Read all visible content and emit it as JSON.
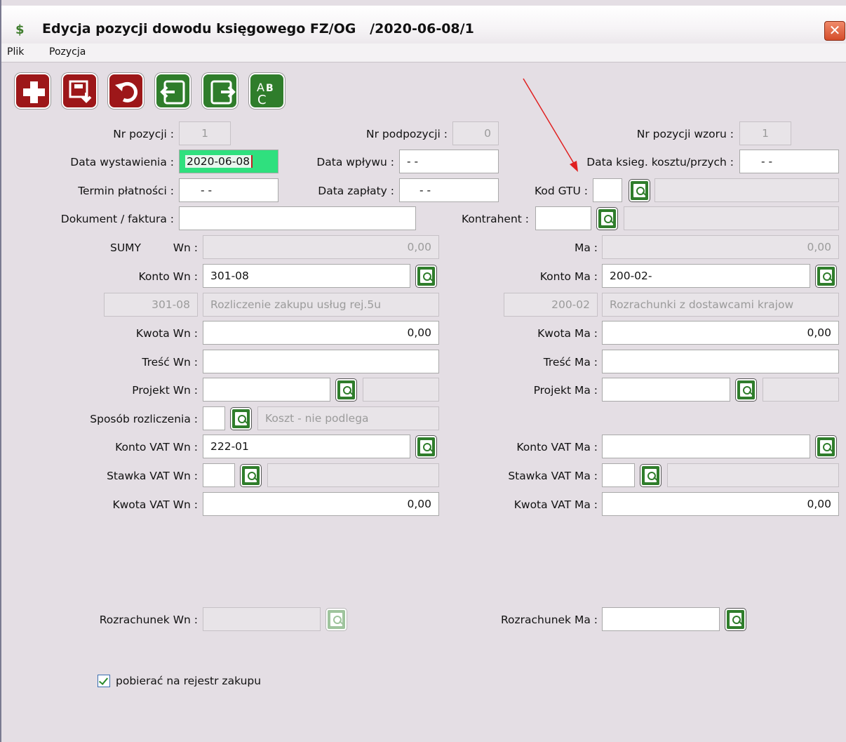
{
  "window": {
    "title": "Edycja pozycji dowodu księgowego FZ/OG   /2020-06-08/1",
    "close": "✕"
  },
  "menu": {
    "file": "Plik",
    "position": "Pozycja"
  },
  "toolbar": {
    "add": "add-icon",
    "save": "save-icon",
    "undo": "undo-icon",
    "prev": "prev-icon",
    "next": "next-icon",
    "spell": "spellcheck-icon",
    "spell_text": "ABC"
  },
  "fields": {
    "nr_pozycji": {
      "label": "Nr pozycji :",
      "value": "1"
    },
    "nr_podpozycji": {
      "label": "Nr podpozycji :",
      "value": "0"
    },
    "nr_pozycji_wzoru": {
      "label": "Nr pozycji wzoru :",
      "value": "1"
    },
    "data_wystawienia": {
      "label": "Data wystawienia :",
      "value": "2020-06-08"
    },
    "data_wplywu": {
      "label": "Data wpływu :",
      "value": "- -"
    },
    "data_ksieg": {
      "label": "Data ksieg. kosztu/przych :",
      "value": "- -"
    },
    "termin_platnosci": {
      "label": "Termin płatności :",
      "value": "- -"
    },
    "data_zaplaty": {
      "label": "Data zapłaty :",
      "value": "- -"
    },
    "kod_gtu": {
      "label": "Kod GTU :",
      "value": "",
      "desc": ""
    },
    "dokument_faktura": {
      "label": "Dokument / faktura :",
      "value": ""
    },
    "kontrahent": {
      "label": "Kontrahent :",
      "value": "",
      "desc": ""
    },
    "sumy_label": "SUMY",
    "sumy_wn": {
      "label": "Wn :",
      "value": "0,00"
    },
    "sumy_ma": {
      "label": "Ma :",
      "value": "0,00"
    },
    "konto_wn": {
      "label": "Konto Wn :",
      "value": "301-08",
      "code": "301-08",
      "desc": "Rozliczenie  zakupu usług  rej.5u"
    },
    "konto_ma": {
      "label": "Konto Ma :",
      "value": "200-02-",
      "code": "200-02",
      "desc": "Rozrachunki  z  dostawcami krajow"
    },
    "kwota_wn": {
      "label": "Kwota Wn :",
      "value": "0,00"
    },
    "kwota_ma": {
      "label": "Kwota Ma :",
      "value": "0,00"
    },
    "tresc_wn": {
      "label": "Treść Wn :",
      "value": ""
    },
    "tresc_ma": {
      "label": "Treść Ma :",
      "value": ""
    },
    "projekt_wn": {
      "label": "Projekt Wn :",
      "value": "",
      "desc": ""
    },
    "projekt_ma": {
      "label": "Projekt Ma :",
      "value": "",
      "desc": ""
    },
    "sposob_rozliczenia": {
      "label": "Sposób rozliczenia :",
      "value": "",
      "desc": "Koszt - nie podlega"
    },
    "konto_vat_wn": {
      "label": "Konto VAT Wn :",
      "value": "222-01"
    },
    "konto_vat_ma": {
      "label": "Konto VAT Ma :",
      "value": ""
    },
    "stawka_vat_wn": {
      "label": "Stawka VAT Wn :",
      "value": "",
      "desc": ""
    },
    "stawka_vat_ma": {
      "label": "Stawka VAT Ma :",
      "value": "",
      "desc": ""
    },
    "kwota_vat_wn": {
      "label": "Kwota VAT Wn :",
      "value": "0,00"
    },
    "kwota_vat_ma": {
      "label": "Kwota VAT Ma :",
      "value": "0,00"
    },
    "rozrachunek_wn": {
      "label": "Rozrachunek Wn :",
      "value": ""
    },
    "rozrachunek_ma": {
      "label": "Rozrachunek Ma :",
      "value": ""
    }
  },
  "checkbox": {
    "label": "pobierać na rejestr zakupu",
    "checked": true
  },
  "colors": {
    "accent_green": "#2f7d2b",
    "accent_red": "#9d1719",
    "annotation_arrow": "#e02020"
  }
}
